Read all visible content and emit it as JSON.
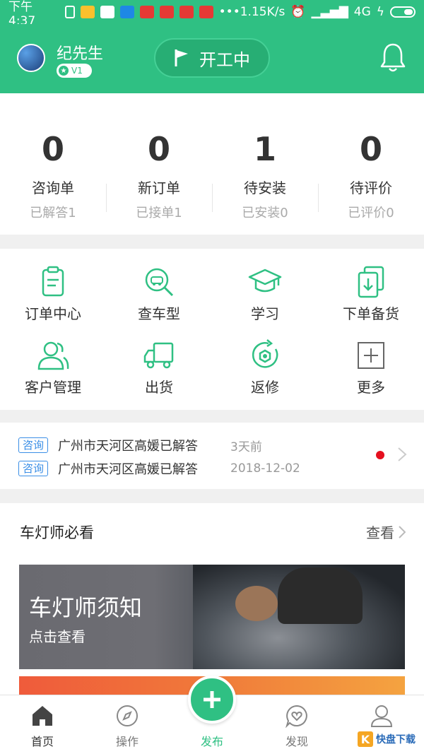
{
  "status_bar": {
    "time": "下午4:37",
    "network_speed": "1.15K/s",
    "network_type": "4G",
    "app_icons": [
      "usb-icon",
      "app-orange",
      "app-video",
      "app-telegram",
      "app-toutiao",
      "app-netease",
      "app-netease-2",
      "app-toutiao-2"
    ]
  },
  "header": {
    "user_name": "纪先生",
    "level": "V1",
    "work_status": "开工中"
  },
  "stats": [
    {
      "value": "0",
      "label": "咨询单",
      "sub": "已解答1"
    },
    {
      "value": "0",
      "label": "新订单",
      "sub": "已接单1"
    },
    {
      "value": "1",
      "label": "待安装",
      "sub": "已安装0"
    },
    {
      "value": "0",
      "label": "待评价",
      "sub": "已评价0"
    }
  ],
  "menu": [
    {
      "label": "订单中心",
      "icon": "clipboard-icon"
    },
    {
      "label": "查车型",
      "icon": "car-search-icon"
    },
    {
      "label": "学习",
      "icon": "graduation-cap-icon"
    },
    {
      "label": "下单备货",
      "icon": "order-stock-icon"
    },
    {
      "label": "客户管理",
      "icon": "customers-icon"
    },
    {
      "label": "出货",
      "icon": "truck-icon"
    },
    {
      "label": "返修",
      "icon": "repair-icon"
    },
    {
      "label": "更多",
      "icon": "plus-box-icon"
    }
  ],
  "notices": [
    {
      "tag": "咨询",
      "text": "广州市天河区高媛已解答",
      "time": "3天前"
    },
    {
      "tag": "咨询",
      "text": "广州市天河区高媛已解答",
      "time": "2018-12-02"
    }
  ],
  "featured": {
    "title": "车灯师必看",
    "more": "查看",
    "banner_title": "车灯师须知",
    "banner_sub": "点击查看"
  },
  "tabbar": [
    {
      "label": "首页",
      "icon": "home-icon"
    },
    {
      "label": "操作",
      "icon": "compass-icon"
    },
    {
      "label": "发布",
      "icon": "plus-icon"
    },
    {
      "label": "发现",
      "icon": "heart-chat-icon"
    },
    {
      "label": "我的",
      "icon": "user-icon"
    }
  ],
  "watermark": {
    "badge": "K",
    "text": "快盘下载"
  },
  "colors": {
    "primary": "#2fc083",
    "tag": "#3a8ee6",
    "unread_dot": "#e5101f"
  }
}
